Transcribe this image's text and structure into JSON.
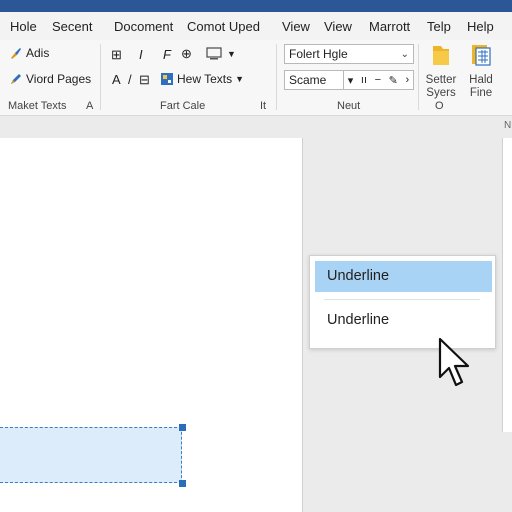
{
  "menu": {
    "items": [
      {
        "label": "Hole"
      },
      {
        "label": "Secent"
      },
      {
        "label": "Docoment"
      },
      {
        "label": "Comot Uped"
      },
      {
        "label": "View"
      },
      {
        "label": "View"
      },
      {
        "label": "Marrott"
      },
      {
        "label": "Telp"
      },
      {
        "label": "Help"
      }
    ]
  },
  "ribbon": {
    "group1": {
      "item1": "Adis",
      "item2": "Viord Pages",
      "label": "Maket Texts",
      "corner": "A"
    },
    "group2": {
      "row1": {
        "b1": "⊞",
        "b2": "I",
        "b3": "F",
        "b4": "⊕"
      },
      "row2": {
        "b1": "A",
        "b2": "/",
        "b3": "⊟",
        "menu_label": "Hew Texts"
      },
      "label": "Fart Cale",
      "corner": "It"
    },
    "group3": {
      "font_value": "Folert Hgle",
      "style_value": "Scame",
      "label": "Neut",
      "corner": "O"
    },
    "group4": {
      "btn1_line1": "Setter",
      "btn1_line2": "Syers",
      "btn2_line1": "Hald",
      "btn2_line2": "Fine"
    }
  },
  "workspace": {
    "right_mark": "N"
  },
  "dropdown": {
    "items": [
      {
        "label": "Underline",
        "highlighted": true
      },
      {
        "label": "Underline",
        "highlighted": false
      }
    ]
  },
  "colors": {
    "titlebar": "#2b5797",
    "highlight": "#a9d3f5",
    "selection_fill": "#dcecfb",
    "selection_border": "#3b7cc4",
    "accent_icon": "#d79a18",
    "blue_icon": "#2f6fc0"
  }
}
